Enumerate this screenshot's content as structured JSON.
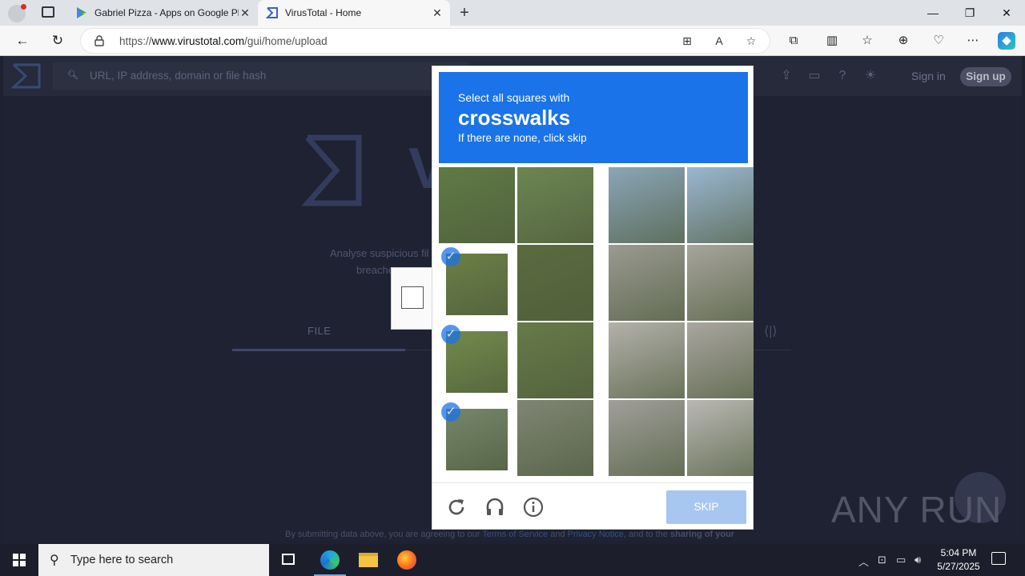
{
  "browser": {
    "tabs": [
      {
        "title": "Gabriel Pizza - Apps on Google Pl",
        "icon": "google-play-icon"
      },
      {
        "title": "VirusTotal - Home",
        "icon": "virustotal-icon",
        "active": true
      }
    ],
    "url_prefix": "https://",
    "url_domain": "www.virustotal.com",
    "url_path": "/gui/home/upload"
  },
  "virustotal": {
    "search_placeholder": "URL, IP address, domain or file hash",
    "sign_in": "Sign in",
    "sign_up": "Sign up",
    "logo_text": "V",
    "desc_line1": "Analyse suspicious fil",
    "desc_line2": "breache",
    "file_tab": "FILE",
    "footer_prefix": "By submitting data above, you are agreeing to our ",
    "footer_tos": "Terms of Service",
    "footer_and": " and ",
    "footer_privacy": "Privacy Notice",
    "footer_suffix": ", and to the ",
    "footer_bold": "sharing of your"
  },
  "captcha": {
    "prompt_line1": "Select all squares with",
    "prompt_target": "crosswalks",
    "prompt_line3": "If there are none, click skip",
    "skip_label": "SKIP",
    "tiles": [
      {
        "image": "grass-hedge",
        "selected": false,
        "color": "#5f7a45"
      },
      {
        "image": "shrub",
        "selected": false,
        "color": "#6c8552"
      },
      {
        "image": "buildings-trees",
        "selected": false,
        "color": "#8aa5b8"
      },
      {
        "image": "building-sky",
        "selected": false,
        "color": "#9ab7d2"
      },
      {
        "image": "grass-motorbike",
        "selected": true,
        "color": "#6b7f47"
      },
      {
        "image": "grass-dirt",
        "selected": false,
        "color": "#5b6b3e"
      },
      {
        "image": "street-pole",
        "selected": false,
        "color": "#9a9a92"
      },
      {
        "image": "street-cars",
        "selected": false,
        "color": "#a7a59d"
      },
      {
        "image": "grass-motorbike",
        "selected": true,
        "color": "#728a4c"
      },
      {
        "image": "grass-litter",
        "selected": false,
        "color": "#677a48"
      },
      {
        "image": "sidewalk",
        "selected": false,
        "color": "#b3b1ab"
      },
      {
        "image": "curb-grate",
        "selected": false,
        "color": "#a9a6a0"
      },
      {
        "image": "grass-curb",
        "selected": true,
        "color": "#76866a"
      },
      {
        "image": "curb",
        "selected": false,
        "color": "#7f8574"
      },
      {
        "image": "sidewalk-curve",
        "selected": false,
        "color": "#a09f9a"
      },
      {
        "image": "curb-edge",
        "selected": false,
        "color": "#b9b8b3"
      }
    ]
  },
  "watermark": "ANY RUN",
  "taskbar": {
    "search_placeholder": "Type here to search",
    "time": "5:04 PM",
    "date": "5/27/2025"
  }
}
